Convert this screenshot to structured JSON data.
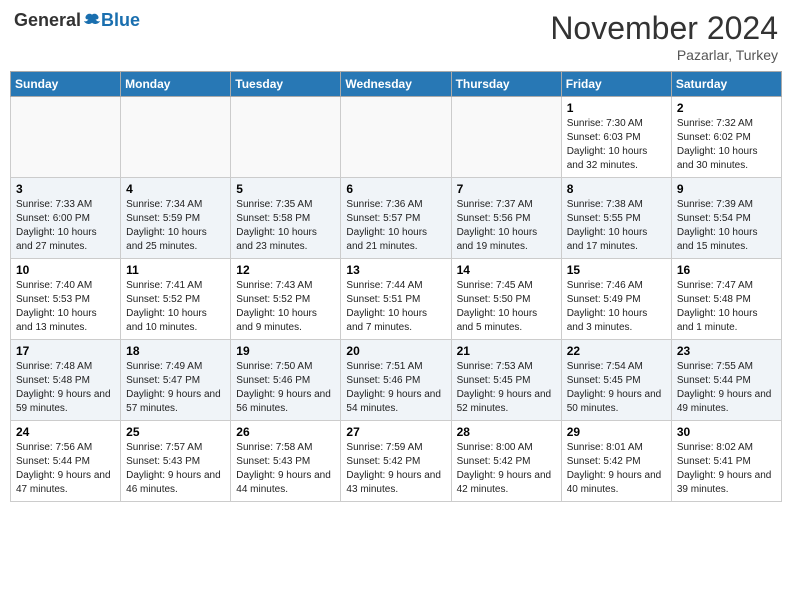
{
  "header": {
    "logo_general": "General",
    "logo_blue": "Blue",
    "month_title": "November 2024",
    "subtitle": "Pazarlar, Turkey"
  },
  "weekdays": [
    "Sunday",
    "Monday",
    "Tuesday",
    "Wednesday",
    "Thursday",
    "Friday",
    "Saturday"
  ],
  "weeks": [
    [
      {
        "day": "",
        "info": ""
      },
      {
        "day": "",
        "info": ""
      },
      {
        "day": "",
        "info": ""
      },
      {
        "day": "",
        "info": ""
      },
      {
        "day": "",
        "info": ""
      },
      {
        "day": "1",
        "info": "Sunrise: 7:30 AM\nSunset: 6:03 PM\nDaylight: 10 hours and 32 minutes."
      },
      {
        "day": "2",
        "info": "Sunrise: 7:32 AM\nSunset: 6:02 PM\nDaylight: 10 hours and 30 minutes."
      }
    ],
    [
      {
        "day": "3",
        "info": "Sunrise: 7:33 AM\nSunset: 6:00 PM\nDaylight: 10 hours and 27 minutes."
      },
      {
        "day": "4",
        "info": "Sunrise: 7:34 AM\nSunset: 5:59 PM\nDaylight: 10 hours and 25 minutes."
      },
      {
        "day": "5",
        "info": "Sunrise: 7:35 AM\nSunset: 5:58 PM\nDaylight: 10 hours and 23 minutes."
      },
      {
        "day": "6",
        "info": "Sunrise: 7:36 AM\nSunset: 5:57 PM\nDaylight: 10 hours and 21 minutes."
      },
      {
        "day": "7",
        "info": "Sunrise: 7:37 AM\nSunset: 5:56 PM\nDaylight: 10 hours and 19 minutes."
      },
      {
        "day": "8",
        "info": "Sunrise: 7:38 AM\nSunset: 5:55 PM\nDaylight: 10 hours and 17 minutes."
      },
      {
        "day": "9",
        "info": "Sunrise: 7:39 AM\nSunset: 5:54 PM\nDaylight: 10 hours and 15 minutes."
      }
    ],
    [
      {
        "day": "10",
        "info": "Sunrise: 7:40 AM\nSunset: 5:53 PM\nDaylight: 10 hours and 13 minutes."
      },
      {
        "day": "11",
        "info": "Sunrise: 7:41 AM\nSunset: 5:52 PM\nDaylight: 10 hours and 10 minutes."
      },
      {
        "day": "12",
        "info": "Sunrise: 7:43 AM\nSunset: 5:52 PM\nDaylight: 10 hours and 9 minutes."
      },
      {
        "day": "13",
        "info": "Sunrise: 7:44 AM\nSunset: 5:51 PM\nDaylight: 10 hours and 7 minutes."
      },
      {
        "day": "14",
        "info": "Sunrise: 7:45 AM\nSunset: 5:50 PM\nDaylight: 10 hours and 5 minutes."
      },
      {
        "day": "15",
        "info": "Sunrise: 7:46 AM\nSunset: 5:49 PM\nDaylight: 10 hours and 3 minutes."
      },
      {
        "day": "16",
        "info": "Sunrise: 7:47 AM\nSunset: 5:48 PM\nDaylight: 10 hours and 1 minute."
      }
    ],
    [
      {
        "day": "17",
        "info": "Sunrise: 7:48 AM\nSunset: 5:48 PM\nDaylight: 9 hours and 59 minutes."
      },
      {
        "day": "18",
        "info": "Sunrise: 7:49 AM\nSunset: 5:47 PM\nDaylight: 9 hours and 57 minutes."
      },
      {
        "day": "19",
        "info": "Sunrise: 7:50 AM\nSunset: 5:46 PM\nDaylight: 9 hours and 56 minutes."
      },
      {
        "day": "20",
        "info": "Sunrise: 7:51 AM\nSunset: 5:46 PM\nDaylight: 9 hours and 54 minutes."
      },
      {
        "day": "21",
        "info": "Sunrise: 7:53 AM\nSunset: 5:45 PM\nDaylight: 9 hours and 52 minutes."
      },
      {
        "day": "22",
        "info": "Sunrise: 7:54 AM\nSunset: 5:45 PM\nDaylight: 9 hours and 50 minutes."
      },
      {
        "day": "23",
        "info": "Sunrise: 7:55 AM\nSunset: 5:44 PM\nDaylight: 9 hours and 49 minutes."
      }
    ],
    [
      {
        "day": "24",
        "info": "Sunrise: 7:56 AM\nSunset: 5:44 PM\nDaylight: 9 hours and 47 minutes."
      },
      {
        "day": "25",
        "info": "Sunrise: 7:57 AM\nSunset: 5:43 PM\nDaylight: 9 hours and 46 minutes."
      },
      {
        "day": "26",
        "info": "Sunrise: 7:58 AM\nSunset: 5:43 PM\nDaylight: 9 hours and 44 minutes."
      },
      {
        "day": "27",
        "info": "Sunrise: 7:59 AM\nSunset: 5:42 PM\nDaylight: 9 hours and 43 minutes."
      },
      {
        "day": "28",
        "info": "Sunrise: 8:00 AM\nSunset: 5:42 PM\nDaylight: 9 hours and 42 minutes."
      },
      {
        "day": "29",
        "info": "Sunrise: 8:01 AM\nSunset: 5:42 PM\nDaylight: 9 hours and 40 minutes."
      },
      {
        "day": "30",
        "info": "Sunrise: 8:02 AM\nSunset: 5:41 PM\nDaylight: 9 hours and 39 minutes."
      }
    ]
  ]
}
